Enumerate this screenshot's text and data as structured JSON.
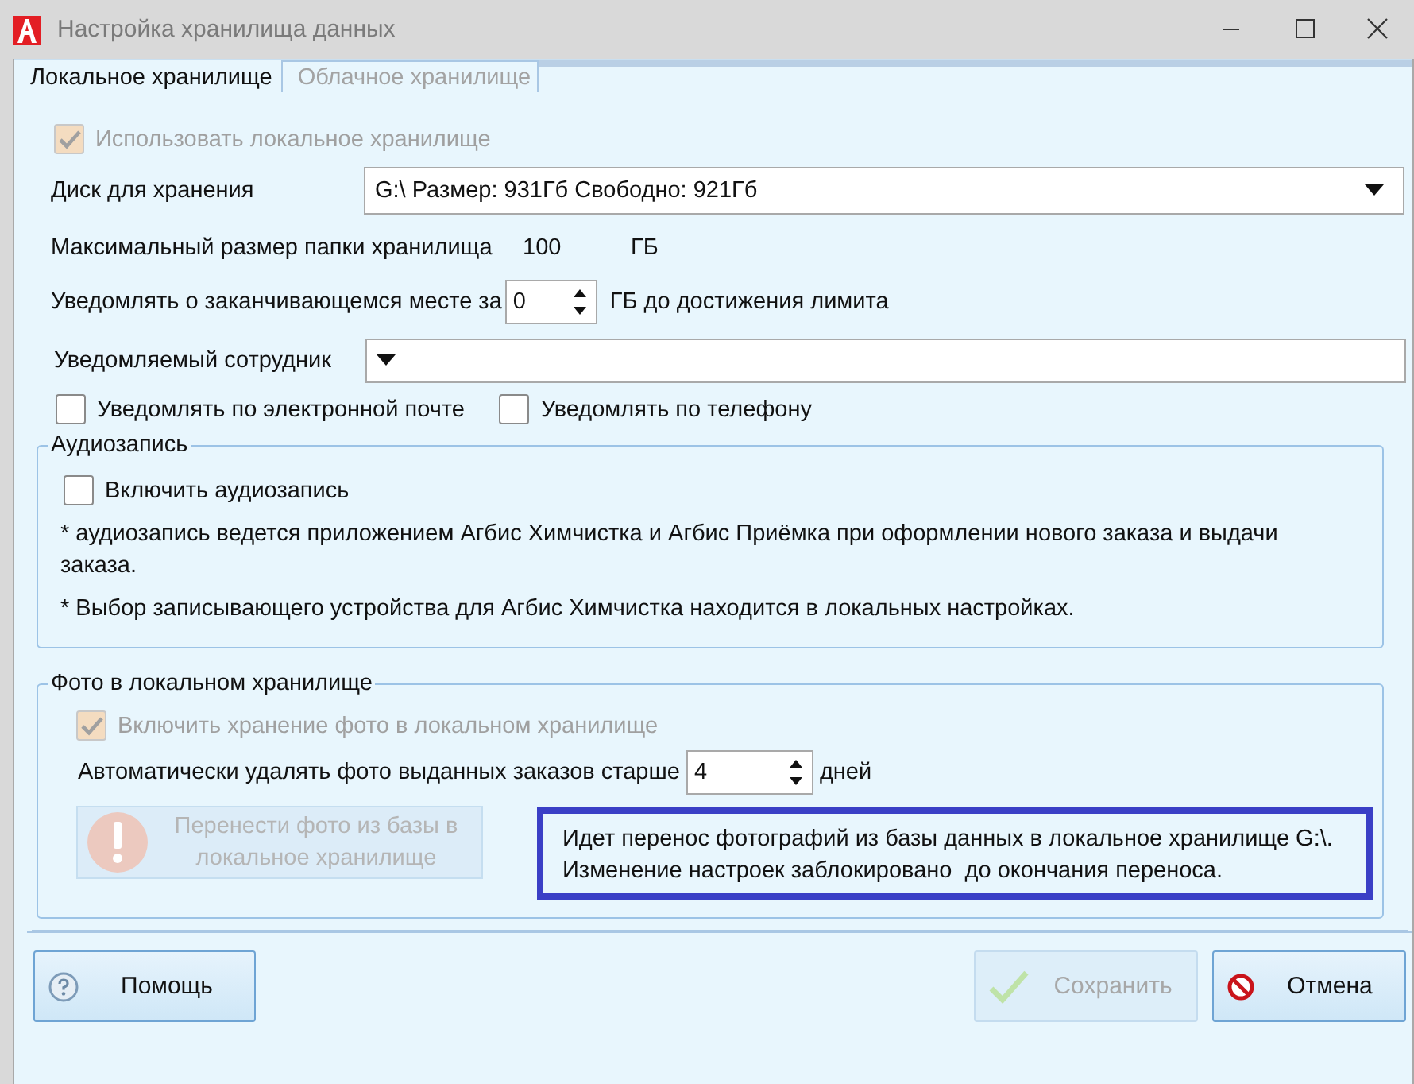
{
  "window": {
    "title": "Настройка хранилища данных"
  },
  "tabs": [
    {
      "label": "Локальное хранилище",
      "selected": true
    },
    {
      "label": "Облачное хранилище",
      "selected": false
    }
  ],
  "use_local": {
    "label": "Использовать локальное хранилище",
    "checked": true,
    "disabled": true
  },
  "disk": {
    "label": "Диск для хранения",
    "value": "G:\\ Размер: 931Гб Свободно: 921Гб"
  },
  "max_size": {
    "label": "Максимальный размер папки хранилища",
    "value": "100",
    "unit": "ГБ"
  },
  "notify_before": {
    "label": "Уведомлять о заканчивающемся месте за",
    "value": "0",
    "suffix": "ГБ до достижения лимита"
  },
  "employee": {
    "label": "Уведомляемый сотрудник"
  },
  "notify_options": [
    {
      "label": "Уведомлять по электронной почте",
      "checked": false
    },
    {
      "label": "Уведомлять по телефону",
      "checked": false
    }
  ],
  "audio": {
    "title": "Аудиозапись",
    "checkbox": {
      "label": "Включить аудиозапись",
      "checked": false
    },
    "notes": [
      "* аудиозапись ведется приложением Агбис Химчистка и Агбис Приёмка при оформлении нового заказа и выдачи заказа.",
      "* Выбор записывающего устройства для Агбис Химчистка находится в локальных настройках."
    ]
  },
  "photo": {
    "title": "Фото в локальном хранилище",
    "checkbox": {
      "label": "Включить хранение фото в локальном хранилище",
      "checked": true,
      "disabled": true
    },
    "auto_delete": {
      "label": "Автоматически удалять фото выданных заказов старше",
      "value": "4",
      "suffix": "дней"
    },
    "transfer_button": {
      "label": "Перенести фото из базы в локальное хранилище",
      "disabled": true
    }
  },
  "notice": [
    "Идет перенос фотографий из базы данных в локальное хранилище G:\\.",
    "Изменение настроек заблокировано  до окончания переноса."
  ],
  "buttons": [
    {
      "kind": "help",
      "label": "Помощь",
      "disabled": false
    },
    {
      "kind": "save",
      "label": "Сохранить",
      "disabled": true
    },
    {
      "kind": "cancel",
      "label": "Отмена",
      "disabled": false
    }
  ]
}
